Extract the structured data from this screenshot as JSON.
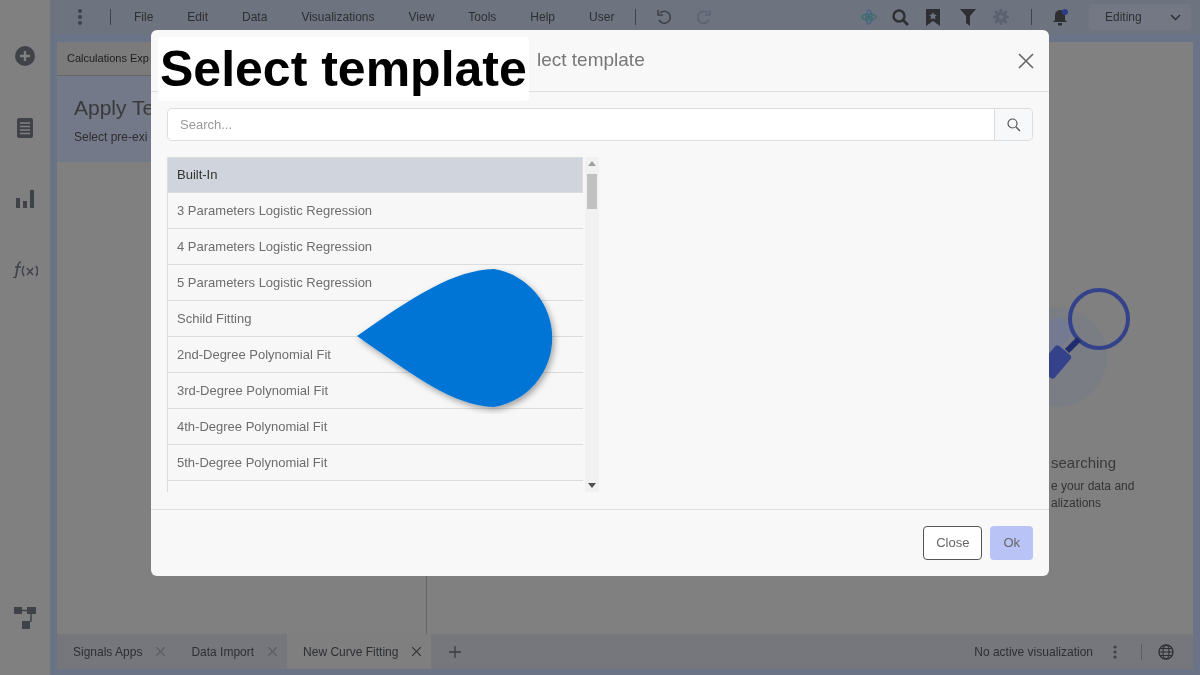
{
  "menu": [
    "File",
    "Edit",
    "Data",
    "Visualizations",
    "View",
    "Tools",
    "Help",
    "User"
  ],
  "mode_dropdown": {
    "value": "Editing"
  },
  "left_panel": {
    "tab": "Calculations Exp",
    "title": "Apply Te",
    "subtitle": "Select pre-exi"
  },
  "empty_state": {
    "title": "searching",
    "lines": [
      "e your data and",
      "alizations"
    ]
  },
  "dialog": {
    "title": "lect template",
    "search": {
      "placeholder": "Search..."
    },
    "items": [
      {
        "label": "Built-In",
        "selected": true
      },
      {
        "label": "3 Parameters Logistic Regression",
        "selected": false
      },
      {
        "label": "4 Parameters Logistic Regression",
        "selected": false
      },
      {
        "label": "5 Parameters Logistic Regression",
        "selected": false
      },
      {
        "label": "Schild Fitting",
        "selected": false
      },
      {
        "label": "2nd-Degree Polynomial Fit",
        "selected": false
      },
      {
        "label": "3rd-Degree Polynomial Fit",
        "selected": false
      },
      {
        "label": "4th-Degree Polynomial Fit",
        "selected": false
      },
      {
        "label": "5th-Degree Polynomial Fit",
        "selected": false
      }
    ],
    "buttons": [
      {
        "label": "Close",
        "kind": "secondary"
      },
      {
        "label": "Ok",
        "kind": "primary"
      }
    ]
  },
  "annotation_label": "Select template",
  "tabs": [
    {
      "label": "Signals Apps",
      "selected": false
    },
    {
      "label": "Data Import",
      "selected": false
    },
    {
      "label": "New Curve Fitting",
      "selected": true
    }
  ],
  "status": "No active visualization"
}
